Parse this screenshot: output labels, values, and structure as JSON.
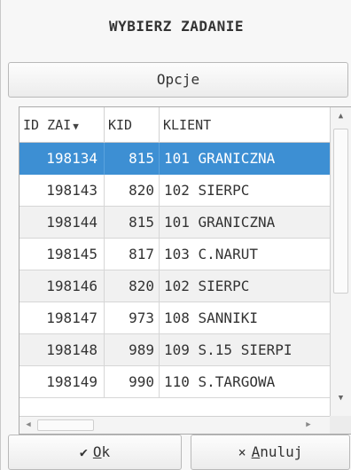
{
  "dialog": {
    "title": "WYBIERZ ZADANIE",
    "options_label": "Opcje"
  },
  "table": {
    "columns": [
      {
        "label": "ID ZAI"
      },
      {
        "label": "KID"
      },
      {
        "label": "KLIENT"
      }
    ],
    "sort_indicator": "▼",
    "selected_row_index": 0,
    "selection_color": "#3d8fd3",
    "rows": [
      {
        "id": "198134",
        "kid": "815",
        "klient": "101 GRANICZNA"
      },
      {
        "id": "198143",
        "kid": "820",
        "klient": "102 SIERPC"
      },
      {
        "id": "198144",
        "kid": "815",
        "klient": "101 GRANICZNA"
      },
      {
        "id": "198145",
        "kid": "817",
        "klient": "103 C.NARUT"
      },
      {
        "id": "198146",
        "kid": "820",
        "klient": "102 SIERPC"
      },
      {
        "id": "198147",
        "kid": "973",
        "klient": "108 SANNIKI"
      },
      {
        "id": "198148",
        "kid": "989",
        "klient": "109 S.15 SIERPI"
      },
      {
        "id": "198149",
        "kid": "990",
        "klient": "110 S.TARGOWA"
      }
    ]
  },
  "buttons": {
    "ok": {
      "icon": "checkmark-icon",
      "glyph": "✔",
      "mnemonic": "O",
      "rest": "k"
    },
    "cancel": {
      "icon": "x-icon",
      "glyph": "×",
      "mnemonic": "A",
      "rest": "nuluj"
    }
  }
}
